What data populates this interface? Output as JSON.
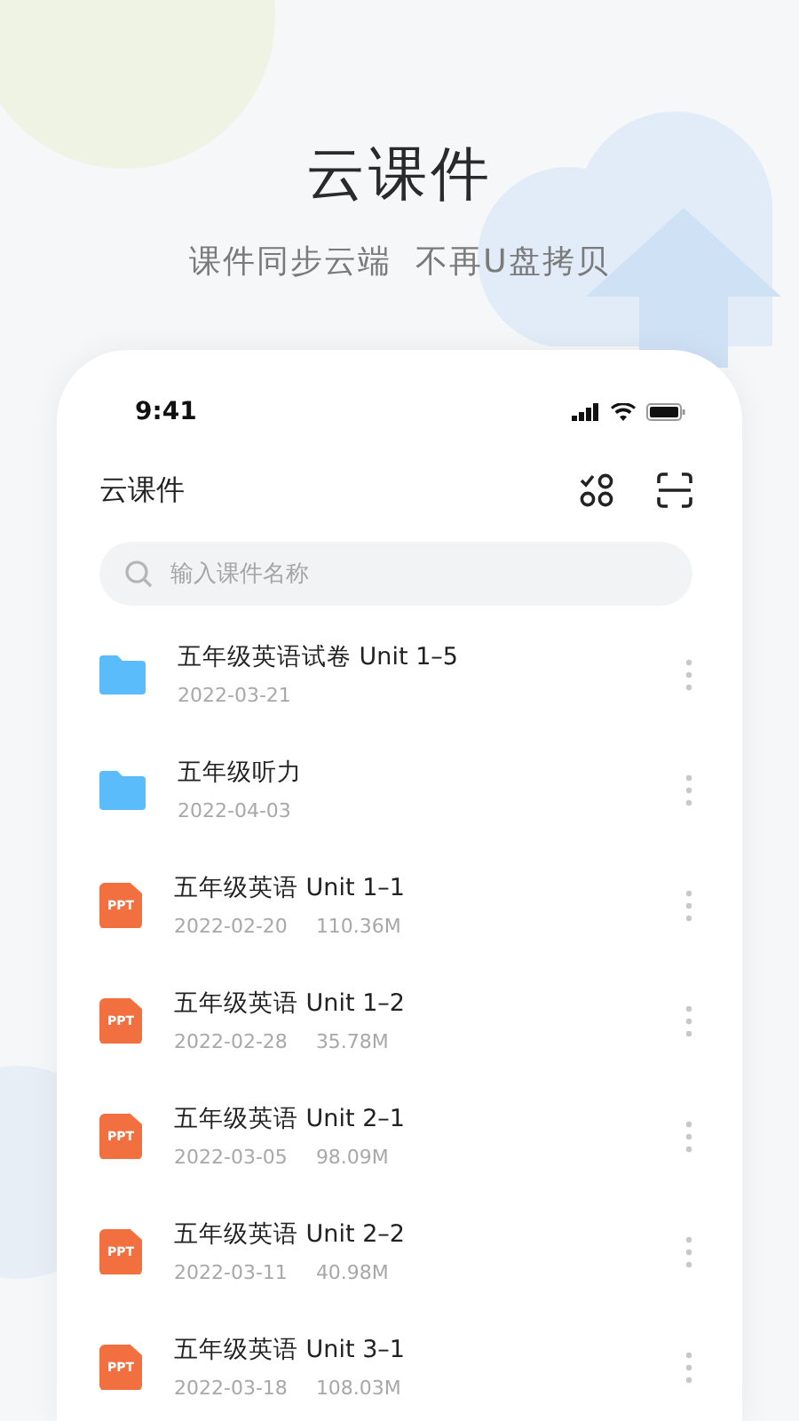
{
  "hero": {
    "title": "云课件",
    "subtitle": "课件同步云端  不再U盘拷贝"
  },
  "status_bar": {
    "time": "9:41"
  },
  "app_bar": {
    "title": "云课件"
  },
  "search": {
    "placeholder": "输入课件名称"
  },
  "files": [
    {
      "kind": "folder",
      "name": "五年级英语试卷 Unit 1–5",
      "date": "2022-03-21"
    },
    {
      "kind": "folder",
      "name": "五年级听力",
      "date": "2022-04-03"
    },
    {
      "kind": "ppt",
      "badge": "PPT",
      "name": "五年级英语 Unit 1–1",
      "date": "2022-02-20",
      "size": "110.36M"
    },
    {
      "kind": "ppt",
      "badge": "PPT",
      "name": "五年级英语 Unit 1–2",
      "date": "2022-02-28",
      "size": "35.78M"
    },
    {
      "kind": "ppt",
      "badge": "PPT",
      "name": "五年级英语 Unit 2–1",
      "date": "2022-03-05",
      "size": "98.09M"
    },
    {
      "kind": "ppt",
      "badge": "PPT",
      "name": "五年级英语 Unit 2–2",
      "date": "2022-03-11",
      "size": "40.98M"
    },
    {
      "kind": "ppt",
      "badge": "PPT",
      "name": "五年级英语 Unit 3–1",
      "date": "2022-03-18",
      "size": "108.03M"
    }
  ]
}
